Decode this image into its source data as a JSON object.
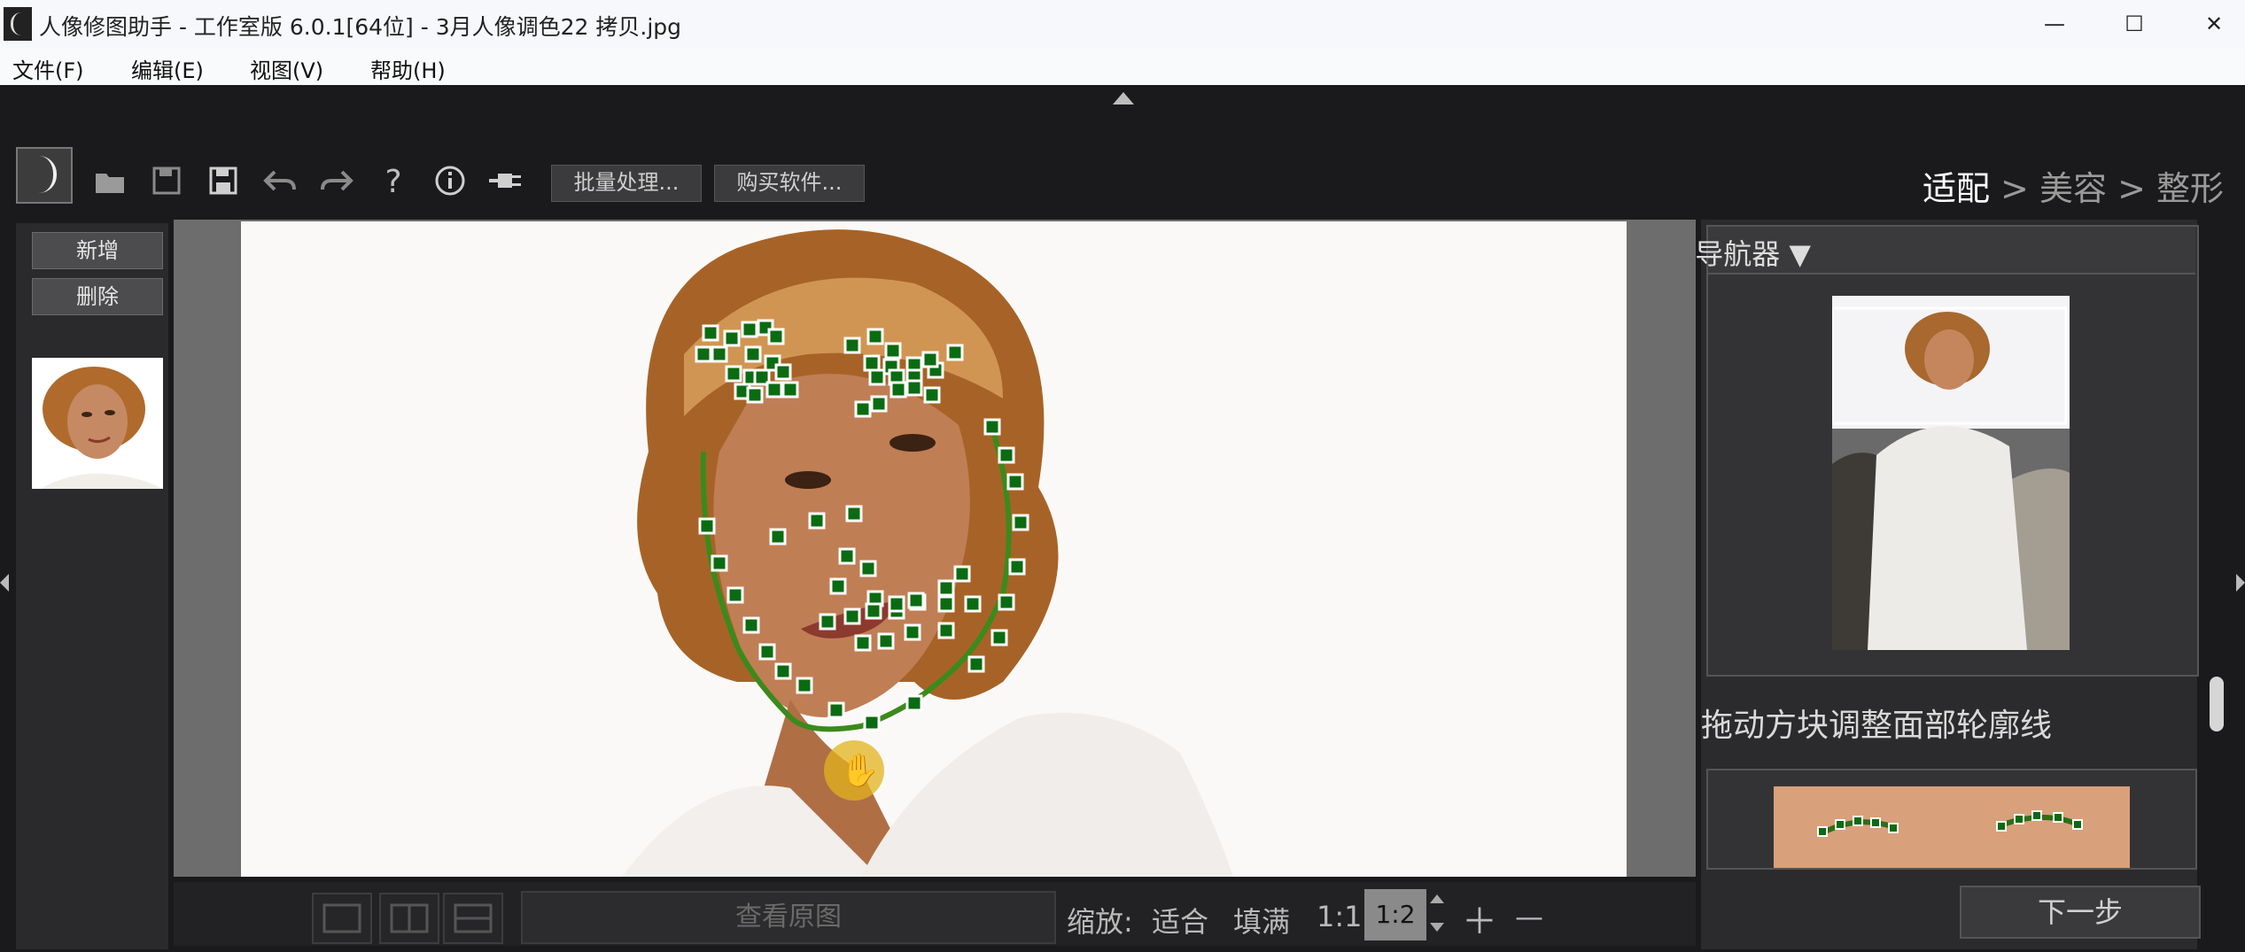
{
  "window": {
    "title": "人像修图助手 - 工作室版 6.0.1[64位] - 3月人像调色22 拷贝.jpg",
    "minimize": "—",
    "maximize": "☐",
    "close": "✕"
  },
  "menu": [
    "文件(F)",
    "编辑(E)",
    "视图(V)",
    "帮助(H)"
  ],
  "toolbar": {
    "batch_label": "批量处理...",
    "buy_label": "购买软件...",
    "icons": [
      "folder-open-icon",
      "save-icon",
      "save-as-icon",
      "undo-icon",
      "redo-icon",
      "help-icon",
      "info-icon",
      "plugin-icon"
    ]
  },
  "steps": {
    "fit": "适配",
    "sep1": " > ",
    "beauty": "美容",
    "sep2": " > ",
    "shape": "整形"
  },
  "left_panel": {
    "add_label": "新增",
    "delete_label": "删除"
  },
  "bottom": {
    "view_original": "查看原图",
    "zoom_label": "缩放:",
    "fit": "适合",
    "fill": "填满",
    "one_to_one": "1:1",
    "one_to_two": "1:2",
    "zoom_in": "＋",
    "zoom_out": "—"
  },
  "right_panel": {
    "navigator_title": "导航器 ▼",
    "hint": "拖动方块调整面部轮廓线",
    "next_label": "下一步"
  },
  "colors": {
    "marker_fill": "#0b6b12",
    "marker_border": "#ffffff",
    "contour": "#3b8a1c",
    "hand_highlight": "#e2b31c"
  }
}
